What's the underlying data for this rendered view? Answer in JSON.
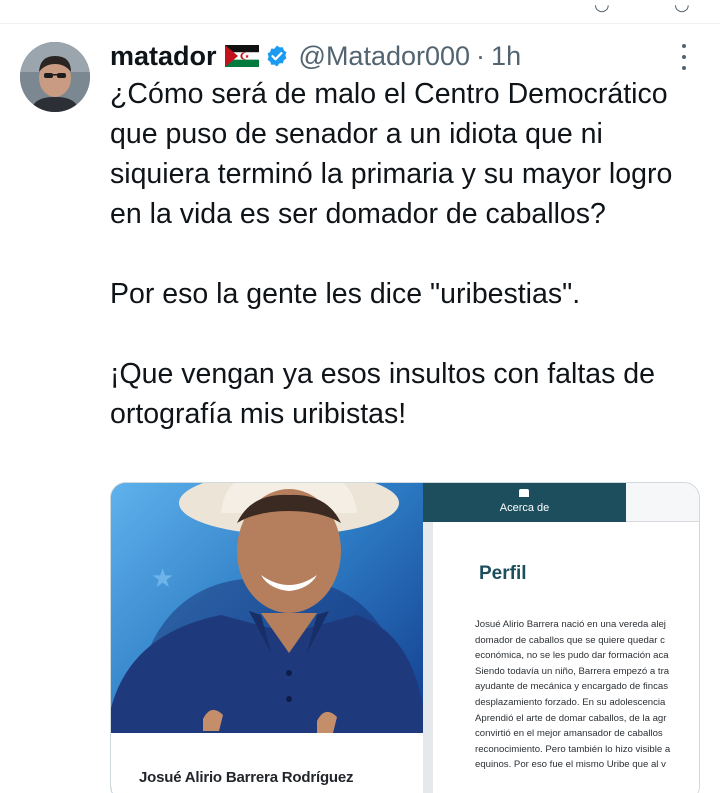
{
  "tweet": {
    "author": {
      "display_name": "matador",
      "flag_icon": "sahrawi-flag-icon",
      "verified_icon": "verified-badge-icon",
      "handle": "@Matador000",
      "separator": "·",
      "time": "1h"
    },
    "text": {
      "p1": "¿Cómo será de malo el Centro Democrático que puso de senador a un idiota que ni siquiera terminó la primaria y su mayor logro en la vida es ser domador de caballos?",
      "p2": "Por eso la gente les dice \"uribestias\".",
      "p3": "¡Que vengan ya esos insultos con faltas de ortografía mis uribistas!"
    },
    "media": {
      "person_caption": "Josué Alirio Barrera Rodríguez",
      "tab_label": "Acerca de",
      "profile_title": "Perfil",
      "bio_lines": [
        "Josué Alirio Barrera nació en una vereda alej",
        "domador de caballos que se quiere quedar c",
        "económica, no se les pudo dar formación aca",
        "Siendo todavía un niño, Barrera empezó a tra",
        "ayudante de mecánica y encargado de fincas",
        "desplazamiento forzado. En su adolescencia",
        "Aprendió el arte de domar caballos, de la agr",
        "convirtió en el mejor amansador de caballos",
        "reconocimiento. Pero también lo hizo visible a",
        "equinos. Por eso fue el mismo Uribe que al v"
      ]
    }
  },
  "colors": {
    "text": "#0f1419",
    "secondary": "#536471",
    "verified": "#1d9bf0",
    "tab": "#1d4e5e"
  }
}
